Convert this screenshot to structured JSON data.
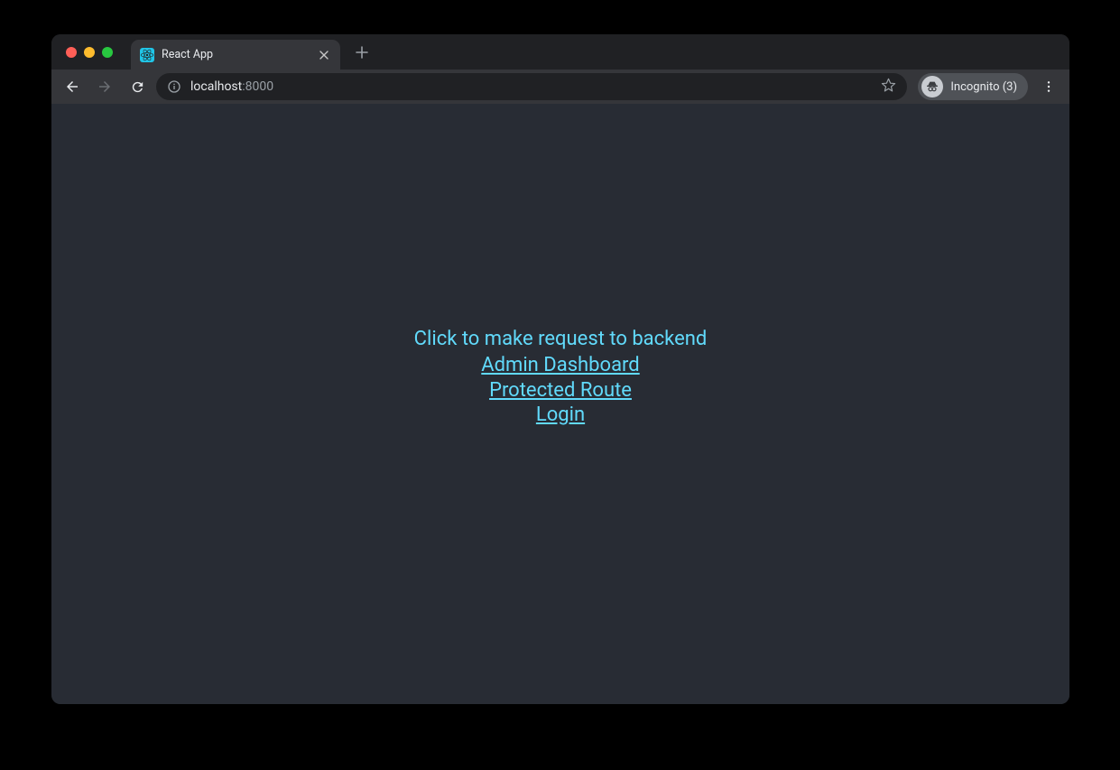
{
  "tab": {
    "title": "React App"
  },
  "address": {
    "host": "localhost",
    "port": ":8000"
  },
  "incognito": {
    "label": "Incognito (3)"
  },
  "page": {
    "heading": "Click to make request to backend",
    "links": {
      "admin": "Admin Dashboard",
      "protected": "Protected Route",
      "login": "Login"
    }
  },
  "colors": {
    "page_bg": "#282c34",
    "link": "#61dafb"
  }
}
